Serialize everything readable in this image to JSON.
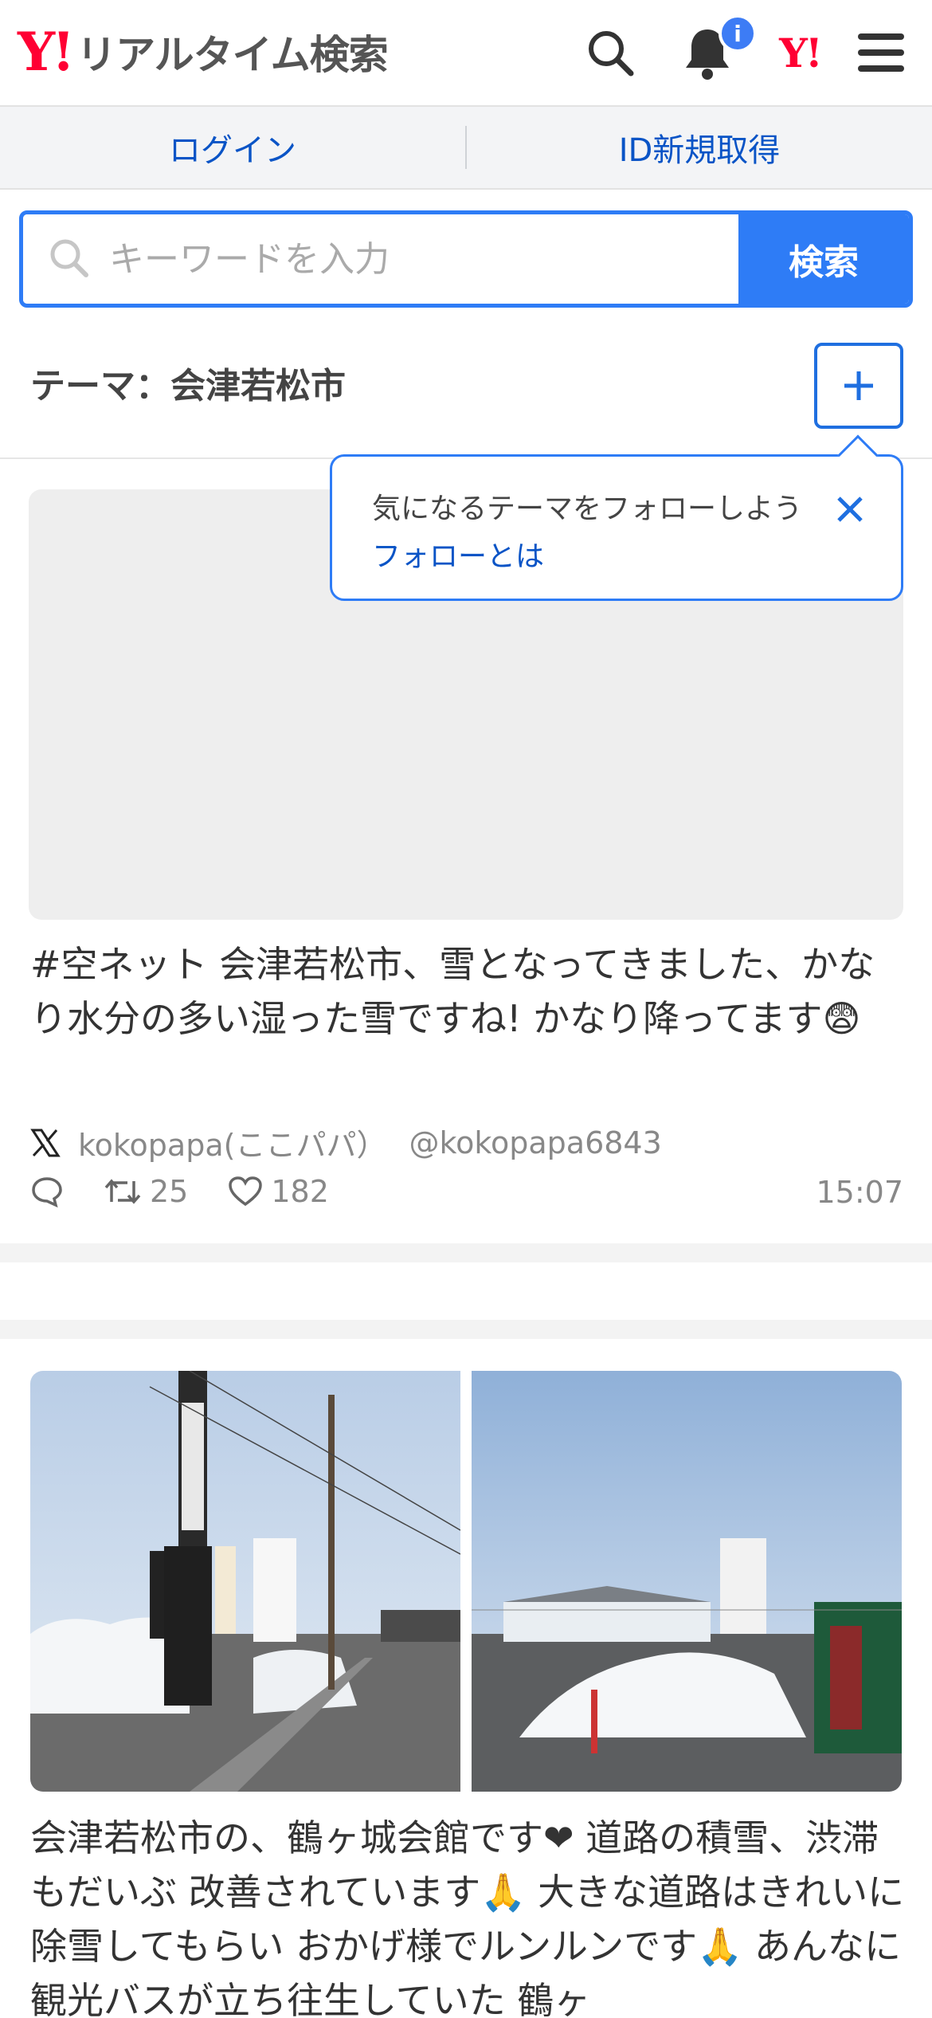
{
  "header": {
    "logo_mark": "Y!",
    "logo_text": "リアルタイム検索",
    "notification_badge": "i",
    "yj_mark": "Y!"
  },
  "loginbar": {
    "login": "ログイン",
    "register": "ID新規取得"
  },
  "search": {
    "placeholder": "キーワードを入力",
    "button": "検索"
  },
  "theme": {
    "label": "テーマ：会津若松市"
  },
  "tooltip": {
    "text": "気になるテーマをフォローしよう",
    "link": "フォローとは"
  },
  "posts": [
    {
      "text": "#空ネット 会津若松市、雪となってきました、かなり水分の多い湿った雪ですね! かなり降ってます😨",
      "author": "kokopapa(ここパパ）",
      "handle": "@kokopapa6843",
      "retweets": "25",
      "likes": "182",
      "time": "15:07"
    },
    {
      "text": "会津若松市の、鶴ヶ城会館です❤ 道路の積雪、渋滞もだいぶ 改善されています🙏 大きな道路はきれいに除雪してもらい おかげ様でルンルンです🙏 あんなに観光バスが立ち往生していた 鶴ヶ"
    }
  ],
  "colors": {
    "brand_red": "#ff0033",
    "link_blue": "#0a54c6",
    "accent_blue": "#2e7cf6"
  }
}
